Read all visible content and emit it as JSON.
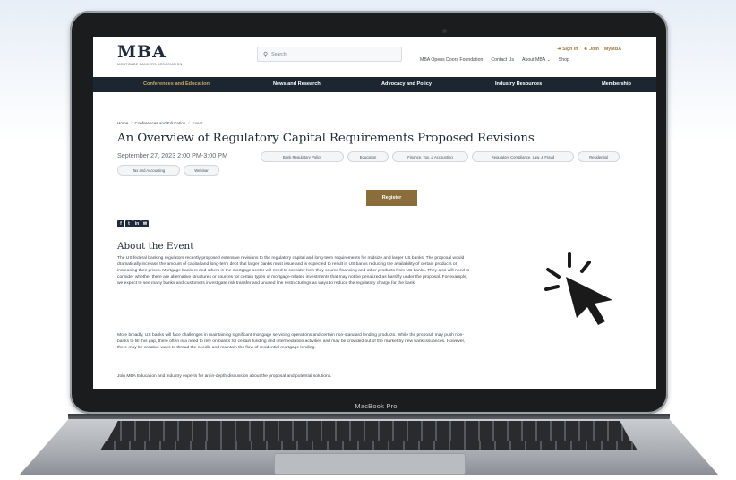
{
  "device": {
    "label": "MacBook Pro"
  },
  "site": {
    "logo_text": "MBA",
    "logo_sub": "MORTGAGE BANKERS ASSOCIATION",
    "search_placeholder": "Search",
    "utility_top": [
      "Sign In",
      "Join",
      "MyMBA"
    ],
    "utility_links": [
      "MBA Opens Doors Foundation",
      "Contact Us",
      "About MBA",
      "Shop"
    ]
  },
  "nav": {
    "items": [
      "Conferences and Education",
      "News and Research",
      "Advocacy and Policy",
      "Industry Resources",
      "Membership"
    ],
    "active_index": 0
  },
  "breadcrumb": [
    "Home",
    "Conferences and Education",
    "Event"
  ],
  "event": {
    "title": "An Overview of Regulatory Capital Requirements Proposed Revisions",
    "datetime": "September 27, 2023 2:00 PM-3:00 PM",
    "tags": [
      "Bank Regulatory Policy",
      "Education",
      "Finance, Tax, & Accounting",
      "Regulatory Compliance, Law, & Fraud",
      "Residential",
      "Tax and Accounting",
      "Webinar"
    ],
    "register_label": "Register",
    "social_icons": [
      "facebook-icon",
      "twitter-icon",
      "linkedin-icon",
      "email-icon"
    ],
    "about_heading": "About the Event",
    "paragraphs": [
      "The US federal banking regulators recently proposed extensive revisions to the regulatory capital and long-term requirements for midsize and larger US banks. The proposal would dramatically increase the amount of capital and long-term debt that larger banks must issue and is expected to result in US banks reducing the availability of certain products or increasing their prices. Mortgage bankers and others in the mortgage sector will need to consider how they source financing and other products from US banks. They also will need to consider whether there are alternative structures or sources for certain types of mortgage-related investments that may not be penalized as harshly under the proposal. For example, we expect to see many banks and customers investigate risk transfer and unused line restructurings as ways to reduce the regulatory charge for the bank.",
      "More broadly, US banks will face challenges in maintaining significant mortgage servicing operations and certain non-standard lending products. While the proposal may push non-banks to fill this gap, there often is a need to rely on banks for certain funding and intermediation activities and may be crowded out of the market by new bank issuances. However, there may be creative ways to thread the needle and maintain the flow of residential mortgage lending.",
      "Join MBA Education and industry experts for an in-depth discussion about the proposal and potential solutions."
    ]
  },
  "colors": {
    "brand_navy": "#1b2631",
    "accent_gold": "#8a6d3b",
    "nav_active": "#c9a663"
  }
}
